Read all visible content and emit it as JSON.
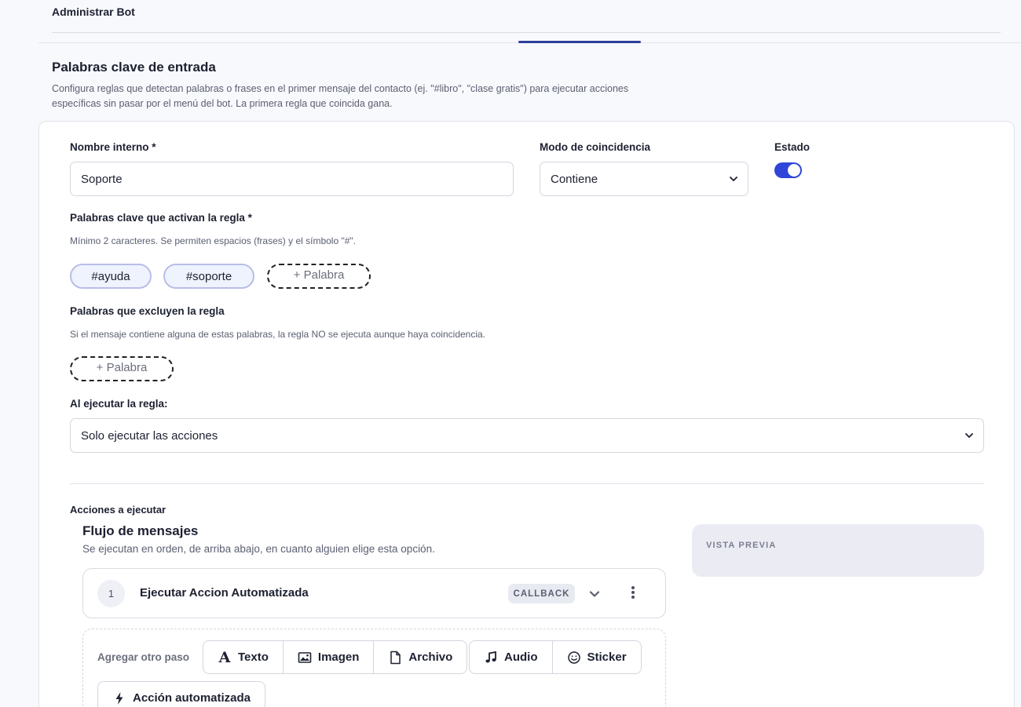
{
  "header": {
    "title": "Administrar Bot"
  },
  "section": {
    "title": "Palabras clave de entrada",
    "description": "Configura reglas que detectan palabras o frases en el primer mensaje del contacto (ej. \"#libro\", \"clase gratis\") para ejecutar acciones específicas sin pasar por el menú del bot. La primera regla que coincida gana."
  },
  "form": {
    "name_label": "Nombre interno *",
    "name_value": "Soporte",
    "mode_label": "Modo de coincidencia",
    "mode_value": "Contiene",
    "status_label": "Estado",
    "status_on": true,
    "keywords_label": "Palabras clave que activan la regla *",
    "keywords_hint": "Mínimo 2 caracteres. Se permiten espacios (frases) y el símbolo \"#\".",
    "keywords": [
      "#ayuda",
      "#soporte"
    ],
    "add_word": "+ Palabra",
    "exclude_label": "Palabras que excluyen la regla",
    "exclude_hint": "Si el mensaje contiene alguna de estas palabras, la regla NO se ejecuta aunque haya coincidencia.",
    "on_execute_label": "Al ejecutar la regla:",
    "on_execute_value": "Solo ejecutar las acciones"
  },
  "actions": {
    "label": "Acciones a ejecutar",
    "flow_title": "Flujo de mensajes",
    "flow_desc": "Se ejecutan en orden, de arriba abajo, en cuanto alguien elige esta opción.",
    "preview_label": "VISTA PREVIA",
    "steps": [
      {
        "number": "1",
        "title": "Ejecutar Accion Automatizada",
        "badge": "CALLBACK"
      }
    ],
    "add_step_label": "Agregar otro paso",
    "buttons": {
      "text": "Texto",
      "image": "Imagen",
      "file": "Archivo",
      "audio": "Audio",
      "sticker": "Sticker",
      "automated": "Acción automatizada"
    }
  },
  "colors": {
    "accent": "#2f46d9",
    "tab_indicator": "#2c3d9a",
    "chip_bg": "#eef3fd"
  }
}
